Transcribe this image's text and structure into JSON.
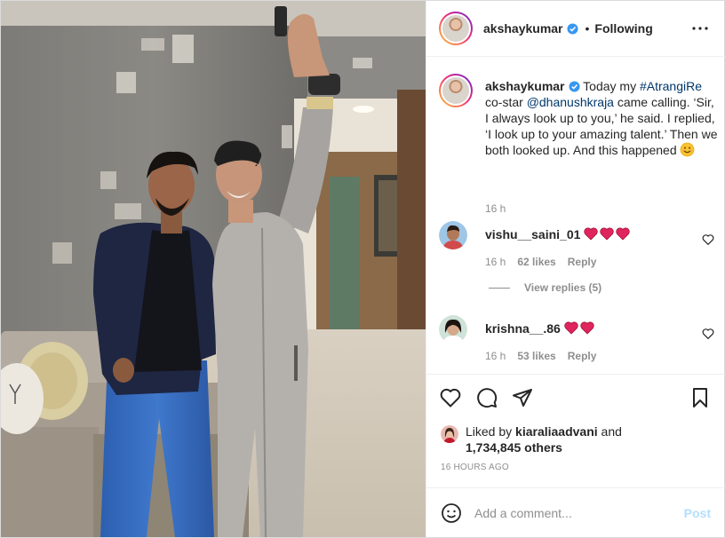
{
  "post": {
    "author": "akshaykumar",
    "follow_state": "Following",
    "dot": "•",
    "caption": {
      "author": "akshaykumar",
      "text_1": " Today my ",
      "hashtag": "#AtrangiRe",
      "text_2": " co-star ",
      "mention": "@dhanushkraja",
      "text_3": " came calling. ‘Sir, I always look up to you,’ he said. I replied, ‘I look up to your amazing talent.’ Then we both looked up. And this happened",
      "time": "16 h"
    },
    "comments": [
      {
        "user": "vishu__saini_01",
        "hearts": 3,
        "time": "16 h",
        "likes": "62 likes",
        "reply": "Reply"
      },
      {
        "user": "krishna__.86",
        "hearts": 2,
        "time": "16 h",
        "likes": "53 likes",
        "reply": "Reply"
      }
    ],
    "view_replies": "View replies (5)",
    "liked_by": {
      "prefix": "Liked by ",
      "user": "kiaraliaadvani",
      "middle": " and",
      "others": "1,734,845 others"
    },
    "age": "16 HOURS AGO"
  },
  "composer": {
    "placeholder": "Add a comment...",
    "post_label": "Post"
  },
  "icons": {
    "verified": "verified-badge-icon",
    "more": "more-options-icon",
    "like": "heart-outline-icon",
    "comment": "comment-bubble-icon",
    "share": "paper-plane-icon",
    "save": "bookmark-icon",
    "emoji": "emoji-smile-icon",
    "comment_like": "small-heart-icon"
  },
  "colors": {
    "link": "#00376b",
    "verified": "#3897f0",
    "heart_red": "#ed4956",
    "muted": "#8e8e8e",
    "post_disabled": "#b2dffc"
  }
}
